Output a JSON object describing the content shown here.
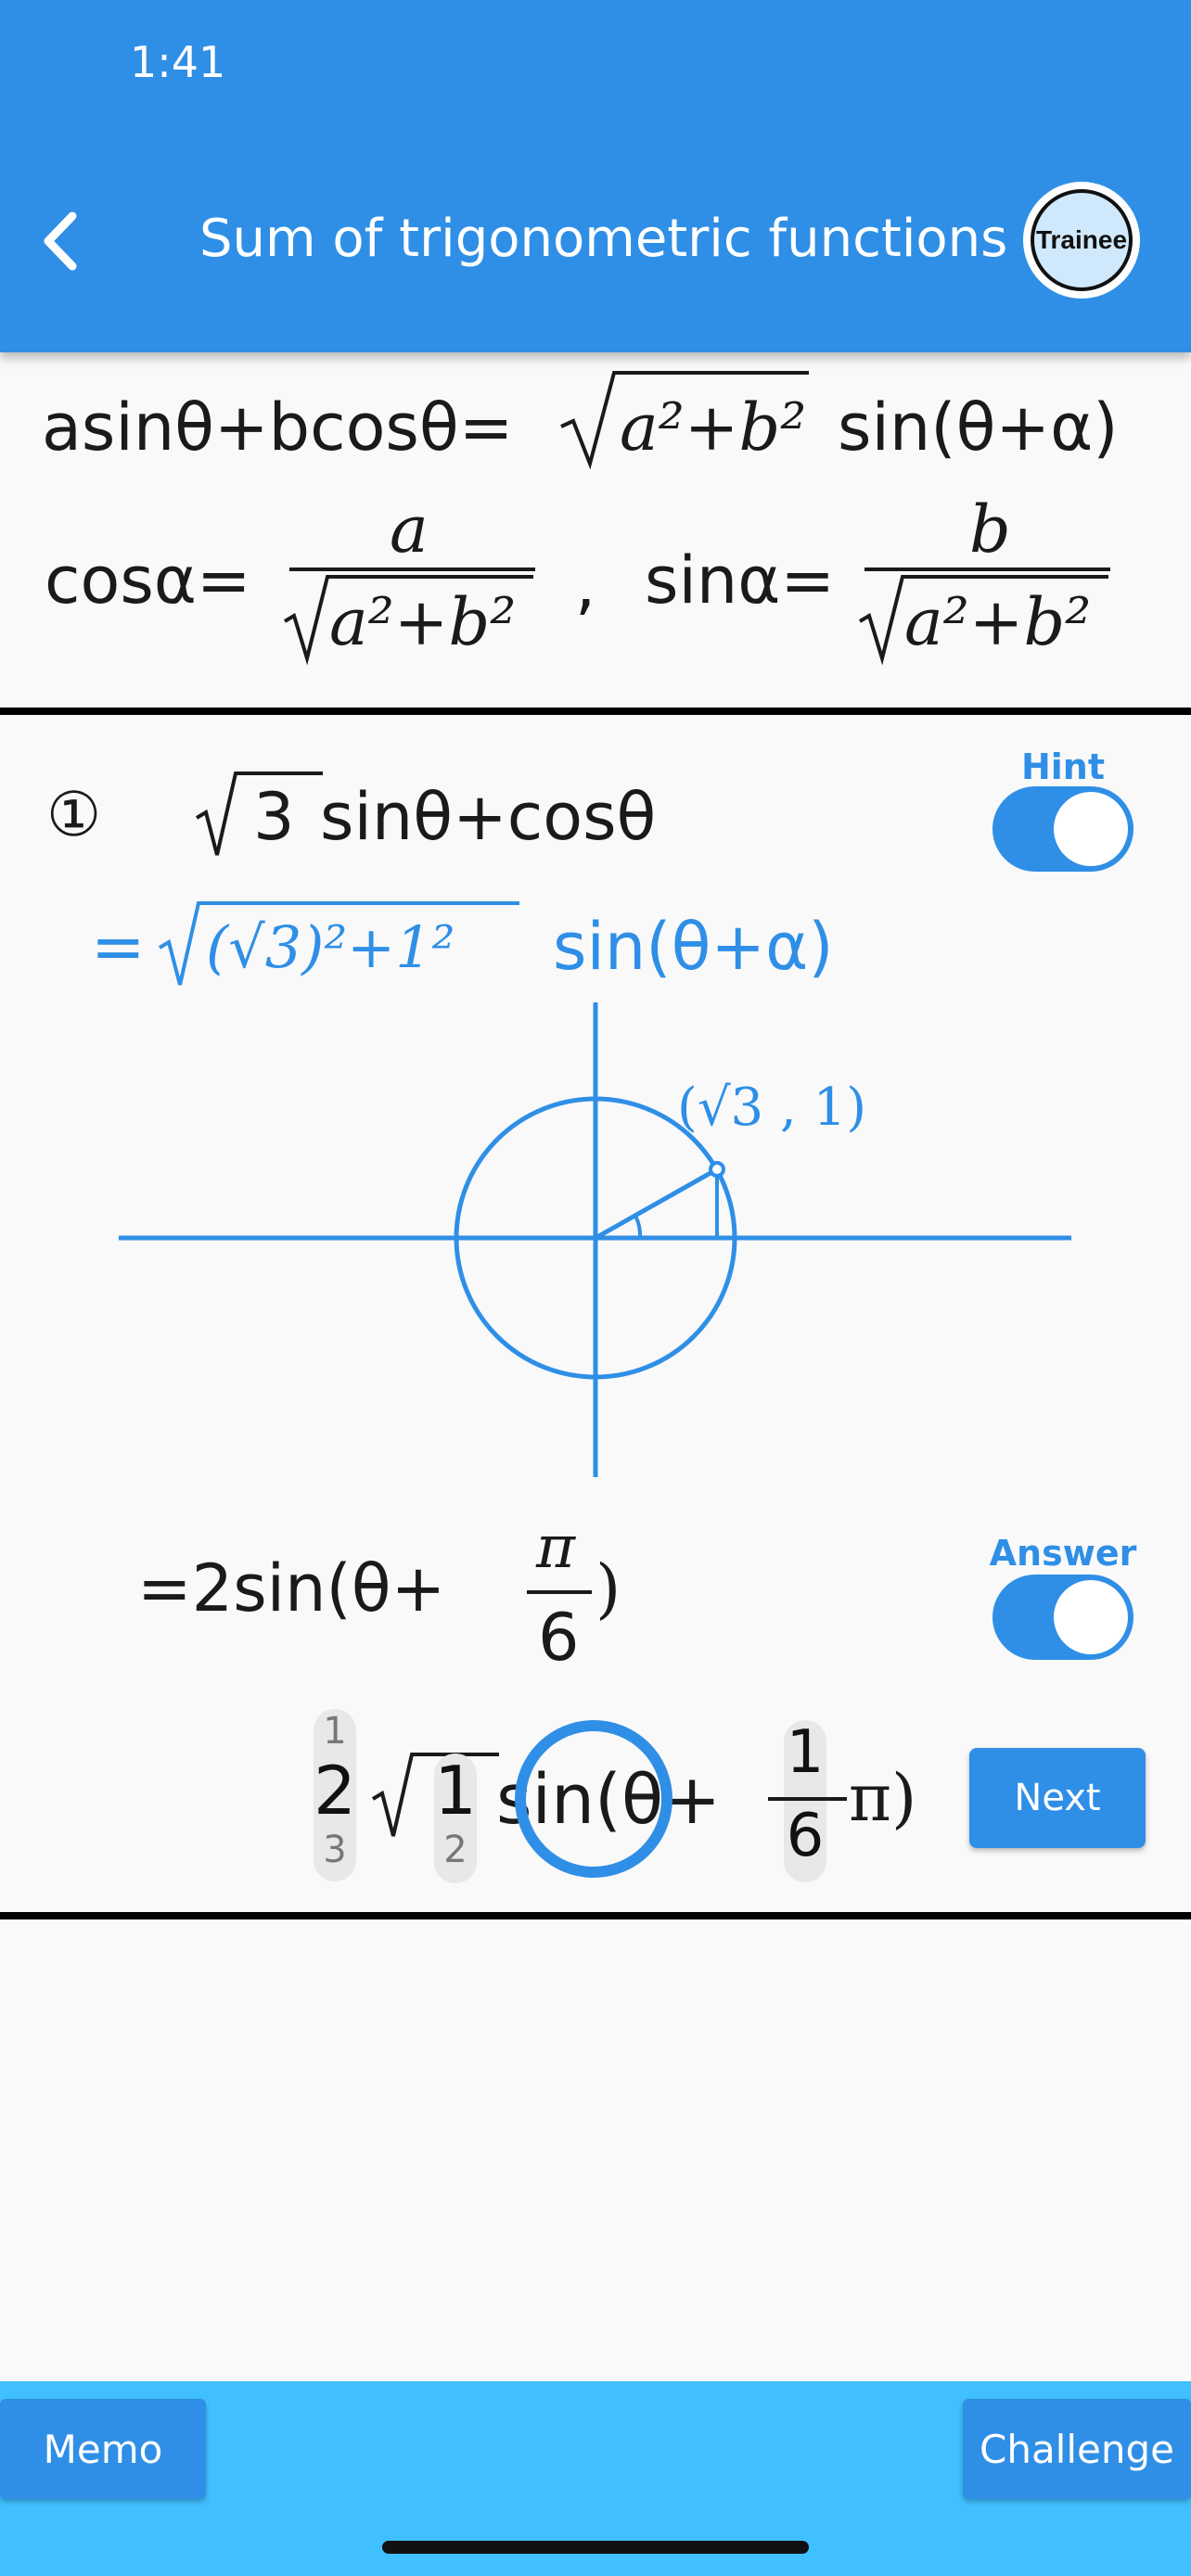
{
  "status_bar": {
    "time": "1:41"
  },
  "header": {
    "title": "Sum of trigonometric functions",
    "rank_badge": "Trainee"
  },
  "formula": {
    "line1_lhs": "asinθ+bcosθ=",
    "line1_sqrt": "a²+b²",
    "line1_rhs": "sin(θ+α)",
    "cos_label": "cosα=",
    "sin_label": "sinα=",
    "frac_a_num": "a",
    "frac_b_num": "b",
    "frac_den": "a²+b²",
    "separator": ","
  },
  "problem": {
    "number": "①",
    "expression_sqrt": "3",
    "expression_rest": "sinθ+cosθ",
    "hint_label": "Hint",
    "hint_step_eq": "=",
    "hint_step_sqrt": "(√3)²+1²",
    "hint_step_rest": "sin(θ+α)",
    "point_label": "(√3 , 1)",
    "answer_label": "Answer",
    "answer_text": "=2sin(θ+",
    "answer_frac_num": "π",
    "answer_frac_den": "6",
    "answer_close": ")"
  },
  "answer_input": {
    "coef": {
      "above": "1",
      "current": "2",
      "below": "3"
    },
    "radicand": {
      "current": "1",
      "below": "2"
    },
    "func": "sin(θ+",
    "frac_num": "1",
    "frac_den": "6",
    "tail": "π)"
  },
  "buttons": {
    "next": "Next",
    "memo": "Memo",
    "challenge": "Challenge"
  },
  "hint_enabled": true,
  "answer_enabled": true,
  "colors": {
    "primary": "#2f8fe6",
    "bottom_bar": "#40c0ff"
  }
}
